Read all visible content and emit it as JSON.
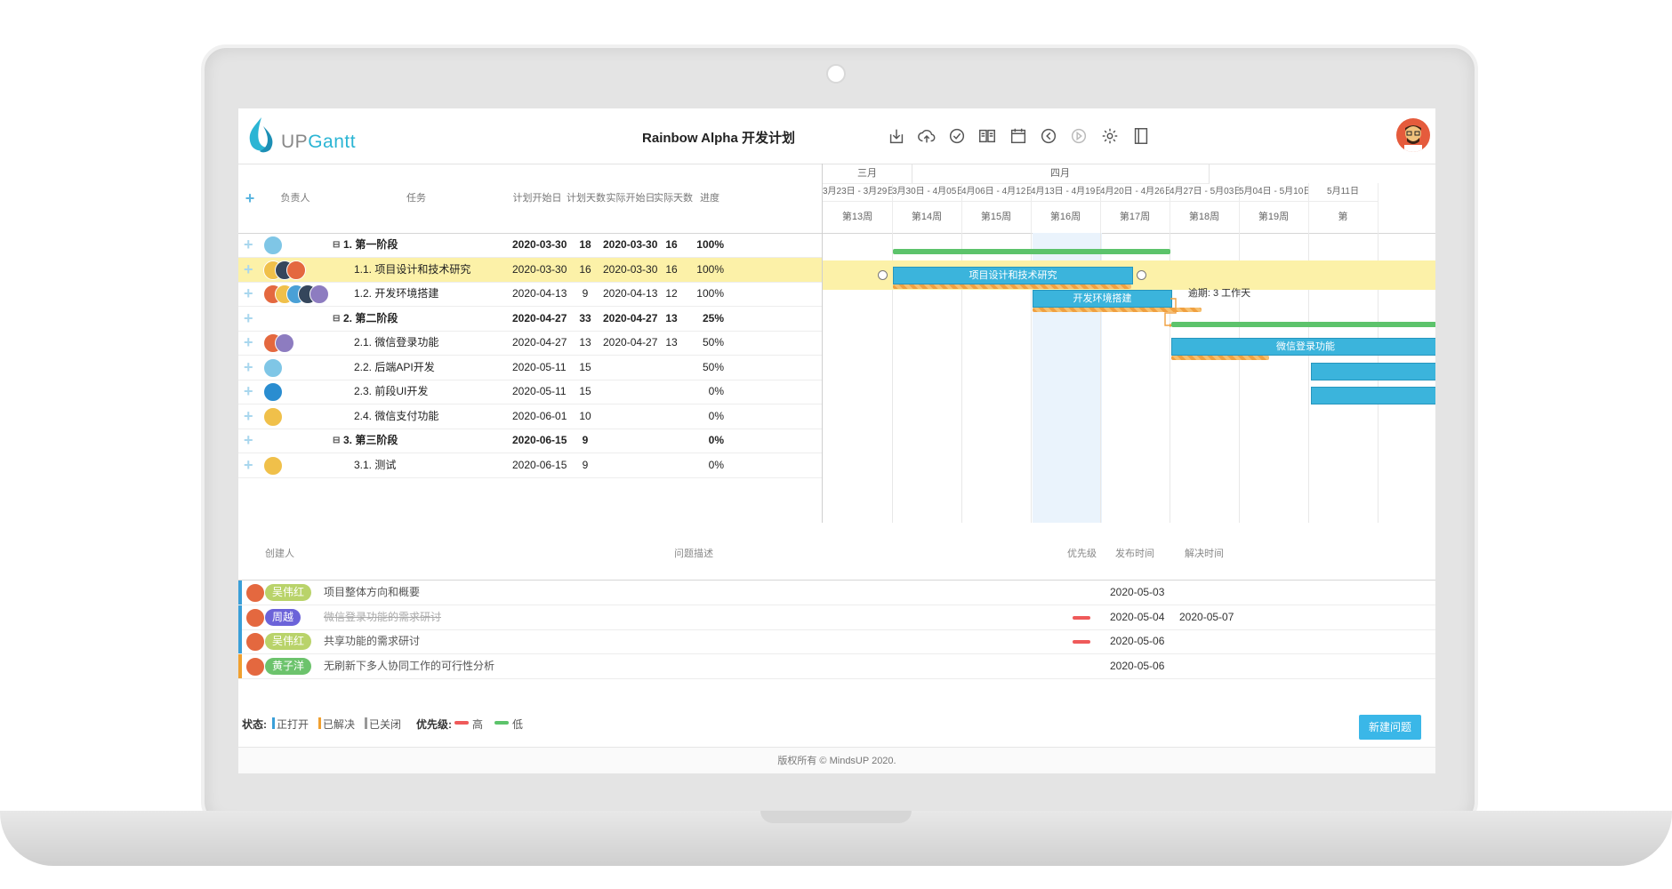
{
  "app": {
    "logo_prefix": "UP",
    "logo_suffix": "Gantt",
    "title": "Rainbow Alpha 开发计划"
  },
  "toolbar": {
    "icons": [
      "download-icon",
      "cloud-upload-icon",
      "badge-icon",
      "book-icon",
      "calendar-icon",
      "back-icon",
      "play-icon",
      "gear-icon",
      "panel-icon"
    ]
  },
  "grid": {
    "headers": {
      "add": "+",
      "owner": "负责人",
      "task": "任务",
      "plan_start": "计划开始日",
      "plan_days": "计划天数",
      "actual_start": "实际开始日",
      "actual_days": "实际天数",
      "progress": "进度"
    },
    "rows": [
      {
        "name": "1. 第一阶段",
        "plan_start": "2020-03-30",
        "plan_days": "18",
        "actual_start": "2020-03-30",
        "actual_days": "16",
        "progress": "100%",
        "group": true
      },
      {
        "name": "1.1. 项目设计和技术研究",
        "plan_start": "2020-03-30",
        "plan_days": "16",
        "actual_start": "2020-03-30",
        "actual_days": "16",
        "progress": "100%",
        "group": false
      },
      {
        "name": "1.2. 开发环境搭建",
        "plan_start": "2020-04-13",
        "plan_days": "9",
        "actual_start": "2020-04-13",
        "actual_days": "12",
        "progress": "100%",
        "group": false
      },
      {
        "name": "2. 第二阶段",
        "plan_start": "2020-04-27",
        "plan_days": "33",
        "actual_start": "2020-04-27",
        "actual_days": "13",
        "progress": "25%",
        "group": true
      },
      {
        "name": "2.1. 微信登录功能",
        "plan_start": "2020-04-27",
        "plan_days": "13",
        "actual_start": "2020-04-27",
        "actual_days": "13",
        "progress": "50%",
        "group": false
      },
      {
        "name": "2.2. 后端API开发",
        "plan_start": "2020-05-11",
        "plan_days": "15",
        "actual_start": "",
        "actual_days": "",
        "progress": "50%",
        "group": false
      },
      {
        "name": "2.3. 前段UI开发",
        "plan_start": "2020-05-11",
        "plan_days": "15",
        "actual_start": "",
        "actual_days": "",
        "progress": "0%",
        "group": false
      },
      {
        "name": "2.4. 微信支付功能",
        "plan_start": "2020-06-01",
        "plan_days": "10",
        "actual_start": "",
        "actual_days": "",
        "progress": "0%",
        "group": false
      },
      {
        "name": "3. 第三阶段",
        "plan_start": "2020-06-15",
        "plan_days": "9",
        "actual_start": "",
        "actual_days": "",
        "progress": "0%",
        "group": true
      },
      {
        "name": "3.1. 测试",
        "plan_start": "2020-06-15",
        "plan_days": "9",
        "actual_start": "",
        "actual_days": "",
        "progress": "0%",
        "group": false
      }
    ]
  },
  "gantt": {
    "months": [
      "三月",
      "四月"
    ],
    "ranges": [
      "3月23日 - 3月29日",
      "3月30日 - 4月05日",
      "4月06日 - 4月12日",
      "4月13日 - 4月19日",
      "4月20日 - 4月26日",
      "4月27日 - 5月03日",
      "5月04日 - 5月10日",
      "5月11日"
    ],
    "weeks": [
      "第13周",
      "第14周",
      "第15周",
      "第16周",
      "第17周",
      "第18周",
      "第19周",
      "第"
    ],
    "bars": {
      "b1": "项目设计和技术研究",
      "b2": "开发环境搭建",
      "b3": "微信登录功能"
    },
    "delay_label": "逾期: 3 工作天"
  },
  "issues": {
    "headers": {
      "creator": "创建人",
      "desc": "问题描述",
      "priority": "优先级",
      "published": "发布时间",
      "resolved": "解决时间"
    },
    "rows": [
      {
        "creator": "吴伟红",
        "desc": "项目整体方向和概要",
        "priority": "",
        "published": "2020-05-03",
        "resolved": "",
        "status_color": "#3a9fd8",
        "pill_color": "#b9d36a"
      },
      {
        "creator": "周越",
        "desc": "微信登录功能的需求研讨",
        "priority": "高",
        "published": "2020-05-04",
        "resolved": "2020-05-07",
        "status_color": "#3a9fd8",
        "pill_color": "#6c63d9"
      },
      {
        "creator": "吴伟红",
        "desc": "共享功能的需求研讨",
        "priority": "高",
        "published": "2020-05-06",
        "resolved": "",
        "status_color": "#3a9fd8",
        "pill_color": "#b9d36a"
      },
      {
        "creator": "黄子洋",
        "desc": "无刷新下多人协同工作的可行性分析",
        "priority": "",
        "published": "2020-05-06",
        "resolved": "",
        "status_color": "#f0a030",
        "pill_color": "#6cc36c"
      }
    ]
  },
  "legend": {
    "status_label": "状态:",
    "open": "正打开",
    "resolved": "已解决",
    "closed": "已关闭",
    "priority_label": "优先级:",
    "high": "高",
    "low": "低"
  },
  "actions": {
    "new_issue": "新建问题"
  },
  "footer": {
    "copyright": "版权所有 © MindsUP 2020."
  }
}
